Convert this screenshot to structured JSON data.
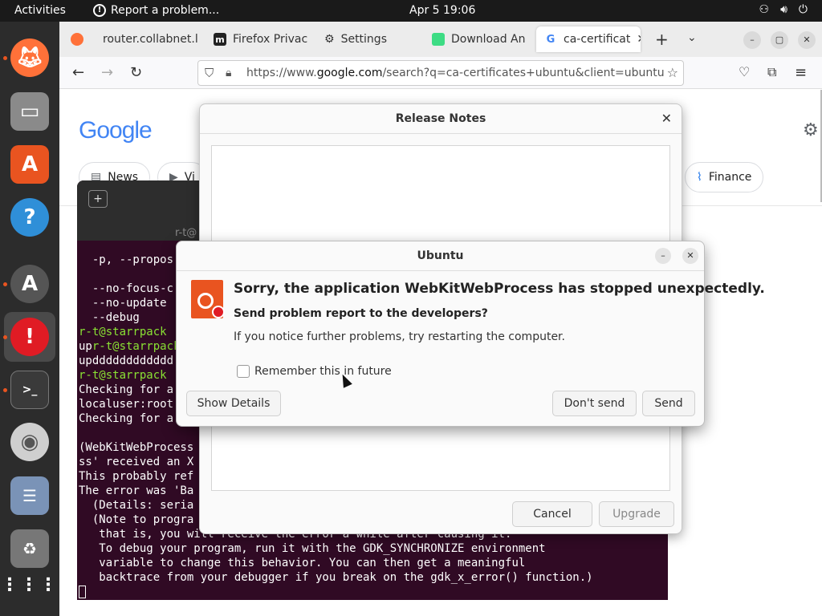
{
  "topbar": {
    "activities": "Activities",
    "notification": "Report a problem...",
    "clock": "Apr 5  19:06"
  },
  "browser": {
    "tabs": [
      {
        "label": "router.collabnet.l"
      },
      {
        "label": "Firefox Privac"
      },
      {
        "label": "Settings"
      },
      {
        "label": "Download An"
      },
      {
        "label": "ca-certificat"
      }
    ],
    "url_prefix": "https://www.",
    "url_domain": "google.com",
    "url_rest": "/search?q=ca-certificates+ubuntu&client=ubuntu"
  },
  "google": {
    "logo": "Google",
    "chips": [
      {
        "label": "News"
      },
      {
        "label": "Vi"
      },
      {
        "label": "Finance"
      }
    ]
  },
  "terminal": {
    "title": "r-t@",
    "lines": [
      {
        "text": "  -p, --propos",
        "prompt": ""
      },
      {
        "text": "",
        "prompt": ""
      },
      {
        "text": "  --no-focus-c",
        "prompt": ""
      },
      {
        "text": "  --no-update",
        "prompt": ""
      },
      {
        "text": "  --debug",
        "prompt": ""
      },
      {
        "text": "",
        "prompt": "r-t@starrpack"
      },
      {
        "text": "",
        "prompt": "up",
        "prompt2": "r-t@starrpack"
      },
      {
        "text": "updddddddddddd",
        "prompt": ""
      },
      {
        "text": "",
        "prompt": "r-t@starrpack"
      },
      {
        "text": "Checking for a",
        "prompt": ""
      },
      {
        "text": "localuser:root",
        "prompt": ""
      },
      {
        "text": "Checking for a",
        "prompt": ""
      },
      {
        "text": "",
        "prompt": ""
      },
      {
        "text": "(WebKitWebProcess",
        "prompt": ""
      },
      {
        "text": "ss' received an X",
        "prompt": ""
      },
      {
        "text": "This probably ref",
        "prompt": ""
      },
      {
        "text": "The error was 'Ba",
        "prompt": ""
      },
      {
        "text": "  (Details: seria",
        "prompt": ""
      },
      {
        "text": "  (Note to progra",
        "prompt": ""
      },
      {
        "text": "   that is, you will receive the error a while after causing it.",
        "prompt": ""
      },
      {
        "text": "   To debug your program, run it with the GDK_SYNCHRONIZE environment",
        "prompt": ""
      },
      {
        "text": "   variable to change this behavior. You can then get a meaningful",
        "prompt": ""
      },
      {
        "text": "   backtrace from your debugger if you break on the gdk_x_error() function.)",
        "prompt": ""
      }
    ]
  },
  "release_notes": {
    "title": "Release Notes",
    "cancel": "Cancel",
    "upgrade": "Upgrade"
  },
  "crash_dialog": {
    "title": "Ubuntu",
    "heading": "Sorry, the application WebKitWebProcess has stopped unexpectedly.",
    "subheading": "Send problem report to the developers?",
    "message": "If you notice further problems, try restarting the computer.",
    "checkbox_label": "Remember this in future",
    "show_details": "Show Details",
    "dont_send": "Don't send",
    "send": "Send"
  },
  "colors": {
    "ubuntu_orange": "#e95420",
    "terminal_bg": "#300a24",
    "prompt_green": "#8ae234"
  }
}
